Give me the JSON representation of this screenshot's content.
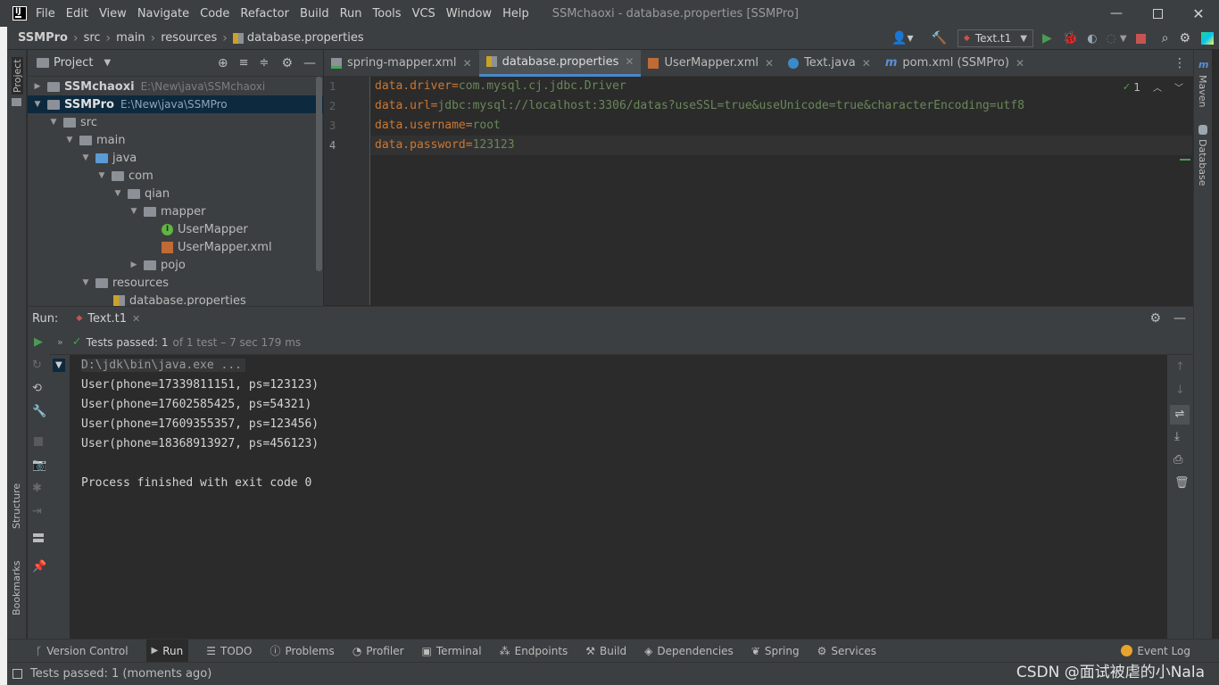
{
  "titlebar": {
    "menu": [
      "File",
      "Edit",
      "View",
      "Navigate",
      "Code",
      "Refactor",
      "Build",
      "Run",
      "Tools",
      "VCS",
      "Window",
      "Help"
    ],
    "title": "SSMchaoxi - database.properties [SSMPro]"
  },
  "breadcrumb": [
    "SSMPro",
    "src",
    "main",
    "resources",
    "database.properties"
  ],
  "toolbar": {
    "run_config": "Text.t1"
  },
  "project": {
    "header": "Project",
    "tree": [
      {
        "label": "SSMchaoxi",
        "path": "E:\\New\\java\\SSMchaoxi"
      },
      {
        "label": "SSMPro",
        "path": "E:\\New\\java\\SSMPro"
      },
      {
        "label": "src"
      },
      {
        "label": "main"
      },
      {
        "label": "java"
      },
      {
        "label": "com"
      },
      {
        "label": "qian"
      },
      {
        "label": "mapper"
      },
      {
        "label": "UserMapper"
      },
      {
        "label": "UserMapper.xml"
      },
      {
        "label": "pojo"
      },
      {
        "label": "resources"
      },
      {
        "label": "database.properties"
      }
    ]
  },
  "tabs": [
    "spring-mapper.xml",
    "database.properties",
    "UserMapper.xml",
    "Text.java",
    "pom.xml (SSMPro)"
  ],
  "editor": {
    "line_numbers": [
      "1",
      "2",
      "3",
      "4"
    ],
    "lines": [
      {
        "key": "data.driver",
        "eq": "=",
        "val": "com.mysql.cj.jdbc.Driver"
      },
      {
        "key": "data.url",
        "eq": "=",
        "val": "jdbc:mysql://localhost:3306/datas?useSSL=true&useUnicode=true&characterEncoding=utf8"
      },
      {
        "key": "data.username",
        "eq": "=",
        "val": "root"
      },
      {
        "key": "data.password",
        "eq": "=",
        "val": "123123"
      }
    ],
    "inspection_count": "1"
  },
  "run": {
    "label": "Run:",
    "tab": "Text.t1",
    "tests_passed": "Tests passed:",
    "tests_count": "1",
    "tests_detail": "of 1 test – 7 sec 179 ms",
    "console": [
      "D:\\jdk\\bin\\java.exe ...",
      "User(phone=17339811151, ps=123123)",
      "User(phone=17602585425, ps=54321)",
      "User(phone=17609355357, ps=123456)",
      "User(phone=18368913927, ps=456123)",
      "",
      "Process finished with exit code 0"
    ]
  },
  "side": {
    "left_top": "Project",
    "left_structure": "Structure",
    "left_bookmarks": "Bookmarks",
    "right_maven": "Maven",
    "right_database": "Database"
  },
  "bottom_tools": [
    "Version Control",
    "Run",
    "TODO",
    "Problems",
    "Profiler",
    "Terminal",
    "Endpoints",
    "Build",
    "Dependencies",
    "Spring",
    "Services"
  ],
  "event_log": "Event Log",
  "status": "Tests passed: 1 (moments ago)",
  "watermark": "CSDN @面试被虐的小Nala",
  "colors": {
    "key": "#cc7832",
    "value": "#6a8759",
    "accent": "#4a88c7",
    "pass": "#499c54"
  }
}
